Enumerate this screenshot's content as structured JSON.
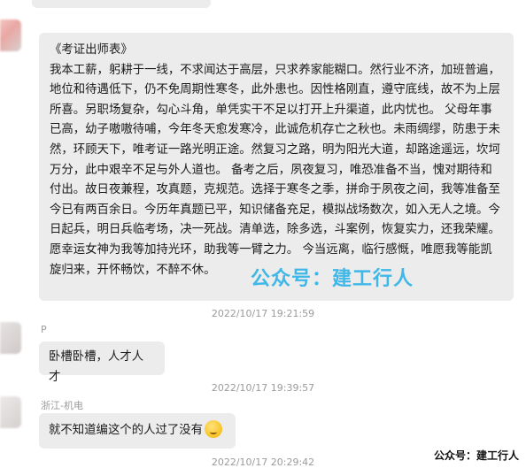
{
  "messages": [
    {
      "sender": "",
      "text": "《考证出师表》\n我本工薪，躬耕于一线，不求闻达于高层，只求养家能糊口。然行业不济，加班普遍，地位和待遇低下，仍不免周期性寒冬，此外患也。因性格刚直，遵守底线，故不为上层所喜。另职场复杂，勾心斗角，单凭实干不足以打开上升渠道，此内忧也。 父母年事已高，幼子嗷嗷待哺，今年冬天愈发寒冷，此诚危机存亡之秋也。未雨绸缪，防患于未然，环顾天下，唯考证一路光明正途。然复习之路，明为阳光大道，却路途遥远，坎坷万分，此中艰辛不足与外人道也。 备考之后，夙夜复习，唯恐准备不当，愧对期待和付出。故日夜兼程，攻真题，克规范。选择于寒冬之季，拼命于夙夜之间，我等准备至今已有两百余日。今历年真题已平，知识储备充足，模拟战场数次，如入无人之境。今日起兵，明日兵临考场，决一死战。清单选，除多选，斗案例，恢复实力，还我荣耀。 愿幸运女神为我等加持光环，助我等一臂之力。 今当远离，临行感慨，唯愿我等能凯旋归来，开怀畅饮，不醉不休。",
      "timestamp": "2022/10/17 19:21:59"
    },
    {
      "sender": "P",
      "text": "卧槽卧槽，人才人才",
      "timestamp": "2022/10/17 19:39:57"
    },
    {
      "sender": "浙江-机电",
      "text": "就不知道编这个的人过了没有",
      "emoji": "wry-smile-emoji",
      "timestamp": "2022/10/17 20:29:42"
    }
  ],
  "watermark": {
    "middle": "公众号：建工行人",
    "corner": "公众号：建工行人"
  },
  "colors": {
    "bubble": "#ececec",
    "timestamp": "#9b9b9b",
    "watermark": "#3fb7e8"
  }
}
